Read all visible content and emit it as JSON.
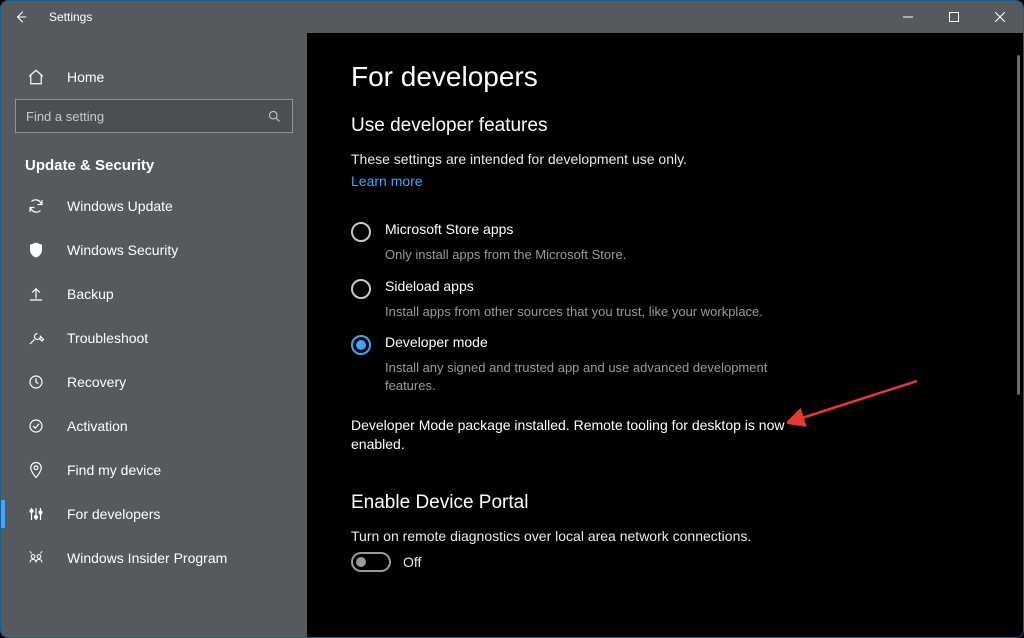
{
  "titlebar": {
    "title": "Settings"
  },
  "sidebar": {
    "home": "Home",
    "search_placeholder": "Find a setting",
    "section": "Update & Security",
    "items": [
      {
        "label": "Windows Update"
      },
      {
        "label": "Windows Security"
      },
      {
        "label": "Backup"
      },
      {
        "label": "Troubleshoot"
      },
      {
        "label": "Recovery"
      },
      {
        "label": "Activation"
      },
      {
        "label": "Find my device"
      },
      {
        "label": "For developers"
      },
      {
        "label": "Windows Insider Program"
      }
    ]
  },
  "main": {
    "title": "For developers",
    "section1": {
      "heading": "Use developer features",
      "desc": "These settings are intended for development use only.",
      "learn_more": "Learn more",
      "radios": [
        {
          "label": "Microsoft Store apps",
          "desc": "Only install apps from the Microsoft Store."
        },
        {
          "label": "Sideload apps",
          "desc": "Install apps from other sources that you trust, like your workplace."
        },
        {
          "label": "Developer mode",
          "desc": "Install any signed and trusted app and use advanced development features."
        }
      ],
      "status": "Developer Mode package installed.  Remote tooling for desktop is now enabled."
    },
    "section2": {
      "heading": "Enable Device Portal",
      "desc": "Turn on remote diagnostics over local area network connections.",
      "toggle_label": "Off"
    }
  }
}
